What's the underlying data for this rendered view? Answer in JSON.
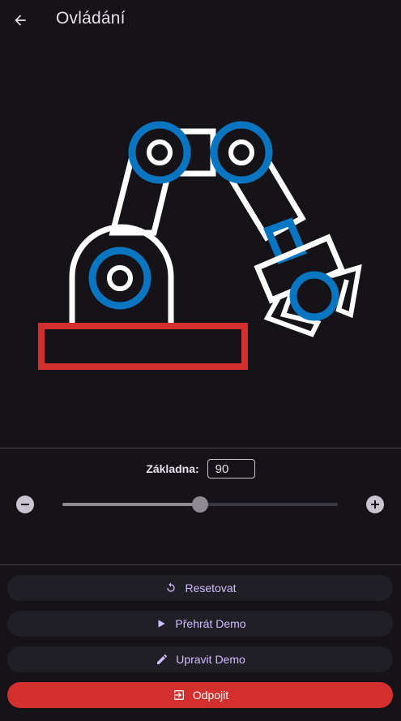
{
  "appbar": {
    "title": "Ovládání",
    "back_icon": "arrow-left-icon"
  },
  "control": {
    "label": "Základna:",
    "value": "90",
    "slider_fraction": 0.5,
    "minus_icon": "minus-circle-icon",
    "plus_icon": "plus-circle-icon"
  },
  "actions": {
    "reset_label": "Resetovat",
    "play_demo_label": "Přehrát Demo",
    "edit_demo_label": "Upravit Demo",
    "disconnect_label": "Odpojit"
  },
  "colors": {
    "background": "#151318",
    "joint_blue": "#0a76c2",
    "base_red": "#d32f2f",
    "accent_purple": "#d0bcff",
    "danger_button": "#d32f2f"
  }
}
